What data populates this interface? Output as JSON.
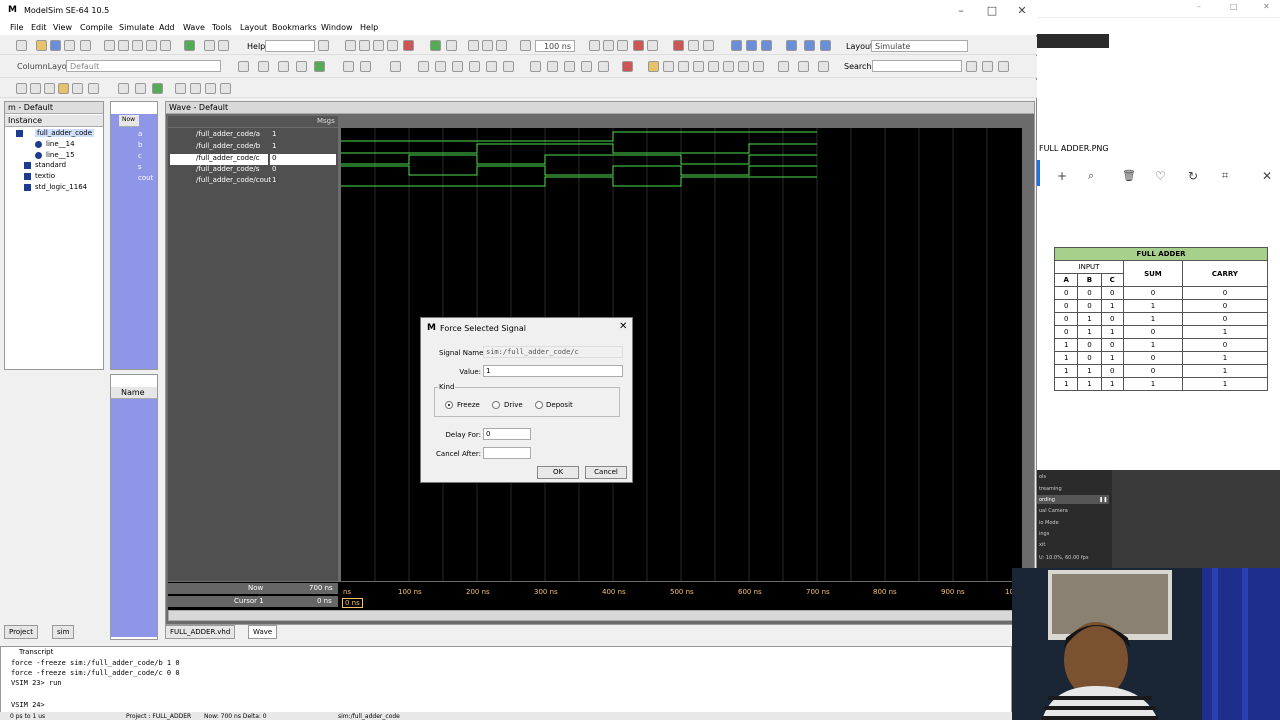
{
  "window": {
    "title": "ModelSim SE-64 10.5"
  },
  "menu": [
    "File",
    "Edit",
    "View",
    "Compile",
    "Simulate",
    "Add",
    "Wave",
    "Tools",
    "Layout",
    "Bookmarks",
    "Window",
    "Help"
  ],
  "toolbar": {
    "help_label": "Help",
    "run_length": "100 ns",
    "layout_label": "Layout",
    "layout_value": "Simulate",
    "search_label": "Search:",
    "column_layout_label": "ColumnLayout",
    "column_layout_value": "Default"
  },
  "sim_pane": {
    "title": "m - Default",
    "header": "Instance",
    "items": [
      "full_adder_code",
      "line__14",
      "line__15",
      "standard",
      "textio",
      "std_logic_1164"
    ]
  },
  "objects_pane": {
    "header": "Now",
    "items": [
      "a",
      "b",
      "c",
      "s",
      "cout"
    ],
    "bottom_header": "Name"
  },
  "wave": {
    "title": "Wave - Default",
    "msgs_label": "Msgs",
    "signals": [
      {
        "name": "/full_adder_code/a",
        "value": "1"
      },
      {
        "name": "/full_adder_code/b",
        "value": "1"
      },
      {
        "name": "/full_adder_code/c",
        "value": "0"
      },
      {
        "name": "/full_adder_code/s",
        "value": "0"
      },
      {
        "name": "/full_adder_code/cout",
        "value": "1"
      }
    ],
    "now_label": "Now",
    "now_value": "700 ns",
    "cursor_label": "Cursor 1",
    "cursor_value": "0 ns",
    "cursor_time": "0 ns",
    "ticks": [
      "ns",
      "100 ns",
      "200 ns",
      "300 ns",
      "400 ns",
      "500 ns",
      "600 ns",
      "700 ns",
      "800 ns",
      "900 ns",
      "10"
    ]
  },
  "tabs": {
    "left": [
      "Project",
      "sim"
    ],
    "main": [
      "FULL_ADDER.vhd",
      "Wave"
    ]
  },
  "dialog": {
    "title": "Force Selected Signal",
    "signal_name_label": "Signal Name:",
    "signal_name_value": "sim:/full_adder_code/c",
    "value_label": "Value:",
    "value_value": "1",
    "kind_label": "Kind",
    "kinds": [
      "Freeze",
      "Drive",
      "Deposit"
    ],
    "delay_label": "Delay For:",
    "delay_value": "0",
    "cancel_after_label": "Cancel After:",
    "cancel_after_value": "",
    "ok_label": "OK",
    "cancel_label": "Cancel"
  },
  "transcript": {
    "title": "Transcript",
    "lines": [
      "force -freeze sim:/full_adder_code/b 1 0",
      "force -freeze sim:/full_adder_code/c 0 0",
      "VSIM 23> run",
      "",
      "VSIM 24>"
    ]
  },
  "status": {
    "range": "0 ps to 1 us",
    "project": "Project : FULL_ADDER",
    "now": "Now: 700 ns  Delta: 0",
    "path": "sim:/full_adder_code"
  },
  "viewer": {
    "title": "FULL ADDER.PNG",
    "table": {
      "title": "FULL ADDER",
      "input_label": "INPUT",
      "cols": [
        "A",
        "B",
        "C",
        "SUM",
        "CARRY"
      ],
      "rows": [
        [
          "0",
          "0",
          "0",
          "0",
          "0"
        ],
        [
          "0",
          "0",
          "1",
          "1",
          "0"
        ],
        [
          "0",
          "1",
          "0",
          "1",
          "0"
        ],
        [
          "0",
          "1",
          "1",
          "0",
          "1"
        ],
        [
          "1",
          "0",
          "0",
          "1",
          "0"
        ],
        [
          "1",
          "0",
          "1",
          "0",
          "1"
        ],
        [
          "1",
          "1",
          "0",
          "0",
          "1"
        ],
        [
          "1",
          "1",
          "1",
          "1",
          "1"
        ]
      ]
    }
  },
  "obs": {
    "lines": [
      "ols",
      "treaming",
      "ording",
      "ual Camera",
      "io Mode",
      "ings",
      "xit",
      "U: 10.0%, 60.00 fps"
    ]
  }
}
